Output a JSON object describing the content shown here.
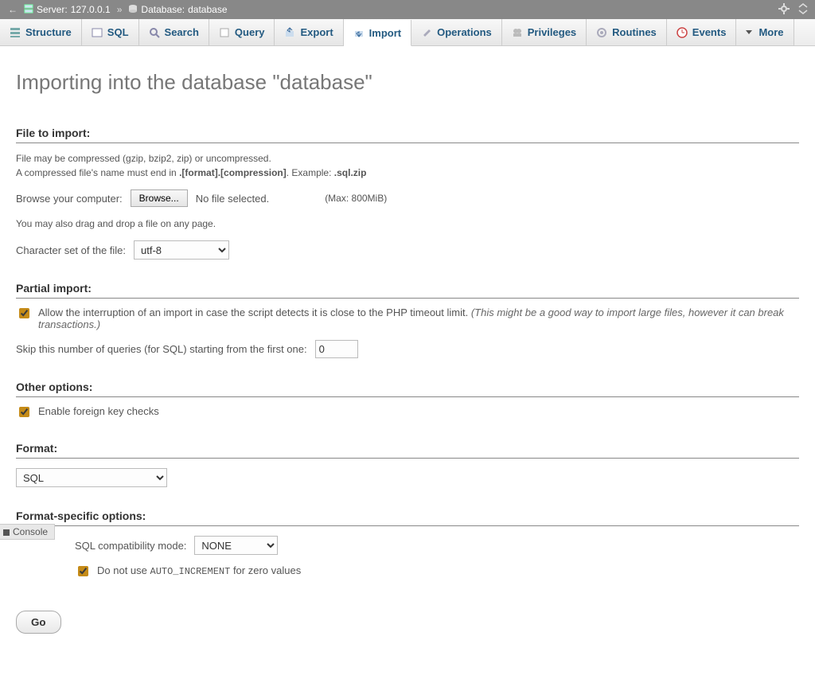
{
  "breadcrumb": {
    "server_label": "Server:",
    "server_value": "127.0.0.1",
    "sep": "»",
    "db_label": "Database:",
    "db_value": "database"
  },
  "tabs": {
    "structure": "Structure",
    "sql": "SQL",
    "search": "Search",
    "query": "Query",
    "export": "Export",
    "import": "Import",
    "operations": "Operations",
    "privileges": "Privileges",
    "routines": "Routines",
    "events": "Events",
    "more": "More"
  },
  "page_title": "Importing into the database \"database\"",
  "file_to_import": {
    "header": "File to import:",
    "note1": "File may be compressed (gzip, bzip2, zip) or uncompressed.",
    "note2a": "A compressed file's name must end in ",
    "note2b": ".[format].[compression]",
    "note2c": ". Example: ",
    "note2d": ".sql.zip",
    "browse_label": "Browse your computer:",
    "browse_btn": "Browse...",
    "no_file": "No file selected.",
    "max": "(Max: 800MiB)",
    "dragdrop": "You may also drag and drop a file on any page.",
    "charset_label": "Character set of the file:",
    "charset_value": "utf-8"
  },
  "partial_import": {
    "header": "Partial import:",
    "allow_interrupt_a": "Allow the interruption of an import in case the script detects it is close to the PHP timeout limit. ",
    "allow_interrupt_b": "(This might be a good way to import large files, however it can break transactions.)",
    "skip_label": "Skip this number of queries (for SQL) starting from the first one:",
    "skip_value": "0"
  },
  "other_options": {
    "header": "Other options:",
    "fk": "Enable foreign key checks"
  },
  "format": {
    "header": "Format:",
    "value": "SQL"
  },
  "format_specific": {
    "header": "Format-specific options:",
    "compat_label": "SQL compatibility mode:",
    "compat_value": "NONE",
    "autoincr_a": "Do not use ",
    "autoincr_b": "AUTO_INCREMENT",
    "autoincr_c": " for zero values"
  },
  "console_label": "Console",
  "go_label": "Go"
}
